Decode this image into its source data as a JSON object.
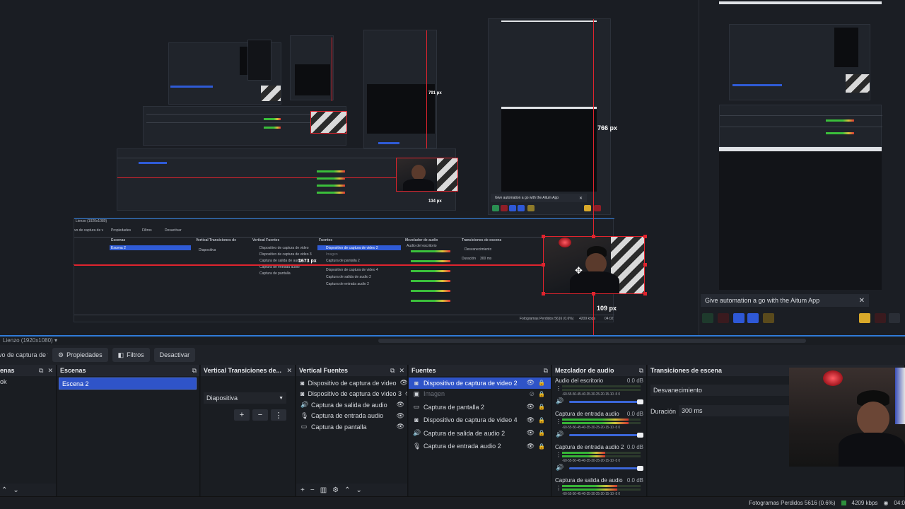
{
  "preview": {
    "px_labels": {
      "label_791": "791 px",
      "label_766": "766 px",
      "label_134": "134 px",
      "label_1673": "1673 px",
      "label_109": "109 px"
    },
    "mini_canvas_label": "Lienzo (1920x1080)",
    "mini_ctx_src": "vo de captura de v",
    "mini_ctx_props": "Propiedades",
    "mini_ctx_filters": "Filtros",
    "mini_ctx_deact": "Desactivar",
    "mini_docks": {
      "scenes": "Escenas",
      "scene_item": "Escena 2",
      "vtrans": "Vertical Transiciones de",
      "vtrans_select": "Diapositiva",
      "vsources": "Vertical Fuentes",
      "vsrc_items": [
        "Dispositivo de captura de video",
        "Dispositivo de captura de video 3",
        "Captura de salida de audio",
        "Captura de entrada audio",
        "Captura de pantalla"
      ],
      "sources": "Fuentes",
      "src_items": [
        "Dispositivo de captura de video 2",
        "Imagen",
        "Captura de pantalla 2",
        "Dispositivo de captura de video 4",
        "Captura de salida de audio 2",
        "Captura de entrada audio 2"
      ],
      "mixer": "Mezclador de audio",
      "mixer_items": [
        "Audio del escritorio",
        "Captura de entrada audio",
        "Captura de entrada audio 2",
        "Captura de salida de audio"
      ],
      "scene_trans": "Transiciones de escena",
      "trans_select": "Desvanecimiento",
      "duration": "Duración",
      "duration_value": "300 ms",
      "status": "Fotogramas Perdidos 5616 (0.6%)",
      "kbps": "4209 kbps",
      "time": "04:02"
    },
    "toast_small": "Give automation a go with the Aitum App",
    "toast_close": "✕"
  },
  "right_panel": {
    "toast_text": "Give automation a go with the Aitum App",
    "toast_close": "✕"
  },
  "canvas_bar": {
    "label": "Lienzo (1920x1080)",
    "dropdown_icon": "▾"
  },
  "context_bar": {
    "source_name": "vo de captura de v",
    "properties_label": "Propiedades",
    "filters_label": "Filtros",
    "deactivate_label": "Desactivar",
    "properties_icon": "gear-icon",
    "filters_icon": "filter-icon"
  },
  "docks": {
    "first": {
      "title": "enas",
      "item": "ok"
    },
    "scenes": {
      "title": "Escenas",
      "selected": "Escena 2"
    },
    "vertical_transitions": {
      "title": "Vertical Transiciones de...",
      "selected": "Diapositiva",
      "add": "+",
      "remove": "−",
      "menu": "⋮"
    },
    "vertical_sources": {
      "title": "Vertical Fuentes",
      "items": [
        {
          "icon": "camera-icon",
          "glyph": "◙",
          "label": "Dispositivo de captura de video"
        },
        {
          "icon": "camera-icon",
          "glyph": "◙",
          "label": "Dispositivo de captura de video 3"
        },
        {
          "icon": "speaker-icon",
          "glyph": "🔊",
          "label": "Captura de salida de audio"
        },
        {
          "icon": "microphone-icon",
          "glyph": "🎙",
          "label": "Captura de entrada audio"
        },
        {
          "icon": "monitor-icon",
          "glyph": "▭",
          "label": "Captura de pantalla"
        }
      ],
      "footer": [
        "+",
        "−",
        "▥",
        "⚙",
        "⌃",
        "⌄"
      ]
    },
    "sources": {
      "title": "Fuentes",
      "items": [
        {
          "icon": "camera-icon",
          "glyph": "◙",
          "label": "Dispositivo de captura de video 2",
          "selected": true,
          "visible": true
        },
        {
          "icon": "image-icon",
          "glyph": "▣",
          "label": "Imagen",
          "selected": false,
          "visible": false
        },
        {
          "icon": "monitor-icon",
          "glyph": "▭",
          "label": "Captura de pantalla 2",
          "selected": false,
          "visible": true
        },
        {
          "icon": "camera-icon",
          "glyph": "◙",
          "label": "Dispositivo de captura de video 4",
          "selected": false,
          "visible": true
        },
        {
          "icon": "speaker-icon",
          "glyph": "🔊",
          "label": "Captura de salida de audio 2",
          "selected": false,
          "visible": true
        },
        {
          "icon": "microphone-icon",
          "glyph": "🎙",
          "label": "Captura de entrada audio 2",
          "selected": false,
          "visible": true
        }
      ]
    },
    "mixer": {
      "title": "Mezclador de audio",
      "scale": "-60-55-50-45-40-35-30-25-20-15-10 -5  0",
      "channels": [
        {
          "name": "Audio del escritorio",
          "db": "0.0 dB",
          "level": 0.0
        },
        {
          "name": "Captura de entrada audio",
          "db": "0.0 dB",
          "level": 0.85
        },
        {
          "name": "Captura de entrada audio 2",
          "db": "0.0 dB",
          "level": 0.55
        },
        {
          "name": "Captura de salida de audio",
          "db": "0.0 dB",
          "level": 0.7
        }
      ]
    },
    "scene_transitions": {
      "title": "Transiciones de escena",
      "selected": "Desvanecimiento",
      "duration_label": "Duración",
      "duration_value": "300 ms"
    }
  },
  "status": {
    "dropped_frames": "Fotogramas Perdidos 5616 (0.6%)",
    "bitrate": "4209 kbps",
    "time": "04:0"
  },
  "colors": {
    "accent_blue": "#2f54c8",
    "selection_red": "#e0242e",
    "canvas_border": "#2f7bd8"
  }
}
